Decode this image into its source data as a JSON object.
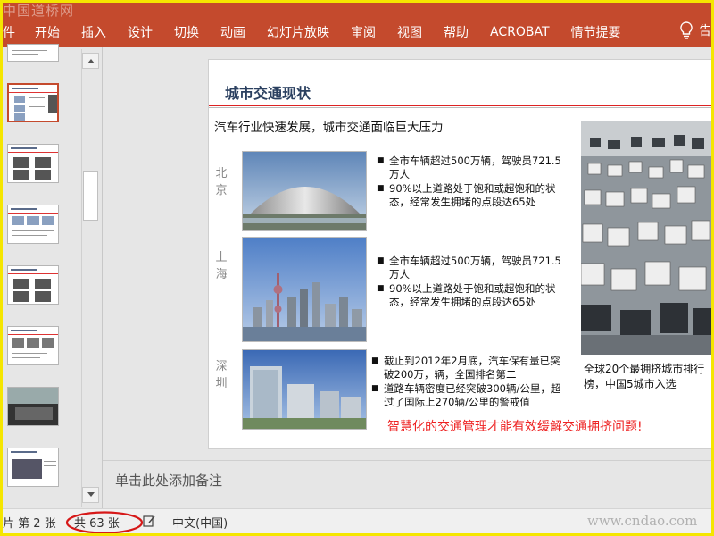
{
  "watermark_top": "中国道桥网",
  "ribbon": {
    "tabs": [
      "件",
      "开始",
      "插入",
      "设计",
      "切换",
      "动画",
      "幻灯片放映",
      "审阅",
      "视图",
      "帮助",
      "ACROBAT",
      "情节提要"
    ],
    "tell_me": "告",
    "accent_color": "#c44a2d"
  },
  "slide": {
    "title": "城市交通现状",
    "subtitle": "汽车行业快速发展，城市交通面临巨大压力",
    "cities": [
      {
        "name": "北京",
        "bullets": [
          "全市车辆超过500万辆，驾驶员721.5万人",
          "90%以上道路处于饱和或超饱和的状态，经常发生拥堵的点段达65处"
        ]
      },
      {
        "name": "上海",
        "bullets": [
          "全市车辆超过500万辆，驾驶员721.5万人",
          "90%以上道路处于饱和或超饱和的状态，经常发生拥堵的点段达65处"
        ]
      },
      {
        "name": "深圳",
        "bullets": [
          "截止到2012年2月底，汽车保有量已突破200万，辆，全国排名第二",
          "道路车辆密度已经突破300辆/公里，超过了国际上270辆/公里的警戒值"
        ]
      }
    ],
    "caption": "全球20个最拥挤城市排行榜，中国5城市入选",
    "conclusion": "智慧化的交通管理才能有效缓解交通拥挤问题!"
  },
  "notes_placeholder": "单击此处添加备注",
  "status": {
    "slide_index": "片 第 2 张",
    "slide_total": "共 63 张",
    "language": "中文(中国)",
    "watermark": "www.cndao.com"
  }
}
